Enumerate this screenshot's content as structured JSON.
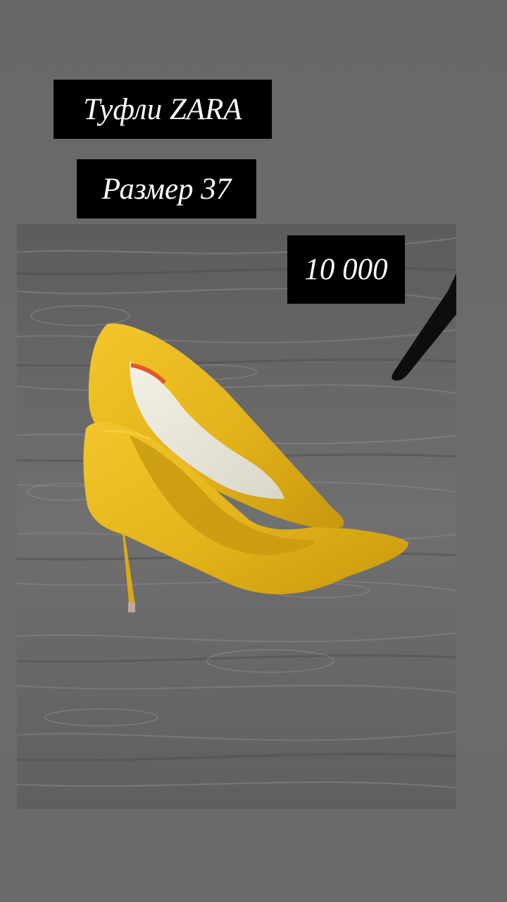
{
  "story": {
    "title": "Туфли ZARA",
    "size": "Размер 37",
    "price": "10 000"
  },
  "photo": {
    "subject": "yellow-pointed-toe-stiletto-pumps",
    "shoe_color": "#e3b61c",
    "floor_color": "#6e6e6e"
  }
}
